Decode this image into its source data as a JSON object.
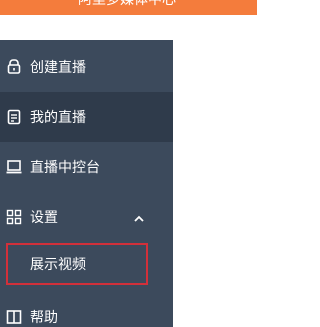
{
  "header": {
    "title": "阿里多媒体中心"
  },
  "sidebar": {
    "items": [
      {
        "label": "创建直播",
        "icon": "lock-icon"
      },
      {
        "label": "我的直播",
        "icon": "document-icon"
      },
      {
        "label": "直播中控台",
        "icon": "monitor-icon"
      },
      {
        "label": "设置",
        "icon": "grid-icon"
      },
      {
        "label": "展示视频"
      },
      {
        "label": "帮助",
        "icon": "book-icon"
      }
    ]
  },
  "colors": {
    "header_bg": "#f47c3c",
    "sidebar_bg": "#3c4a5c",
    "active_bg": "#2f3b4b",
    "highlight_border": "#d2303a"
  }
}
